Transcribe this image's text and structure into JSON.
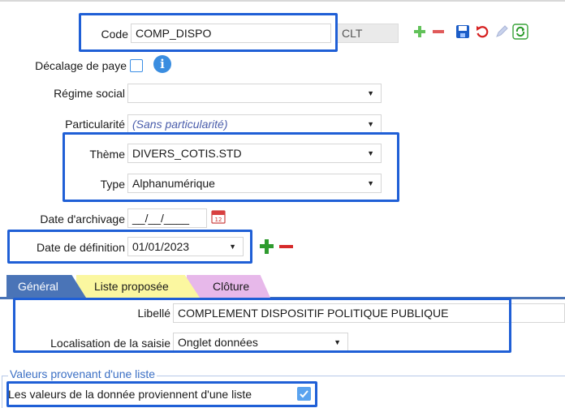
{
  "form": {
    "code": {
      "label": "Code",
      "value": "COMP_DISPO",
      "suffix": "CLT"
    },
    "decalage": {
      "label": "Décalage de paye"
    },
    "regime": {
      "label": "Régime social",
      "value": ""
    },
    "particularite": {
      "label": "Particularité",
      "value": "(Sans particularité)"
    },
    "theme": {
      "label": "Thème",
      "value": "DIVERS_COTIS.STD"
    },
    "type": {
      "label": "Type",
      "value": "Alphanumérique"
    },
    "archivage": {
      "label": "Date d'archivage",
      "value": "__/__/____"
    },
    "definition": {
      "label": "Date de définition",
      "value": "01/01/2023"
    }
  },
  "toolbar": {
    "icons": [
      "add-icon",
      "remove-icon",
      "save-icon",
      "undo-icon",
      "edit-icon",
      "refresh-icon"
    ]
  },
  "tabs": [
    {
      "label": "Général",
      "color": "#4a74b7"
    },
    {
      "label": "Liste proposée",
      "color": "#fbf7a0"
    },
    {
      "label": "Clôture",
      "color": "#e7b8ea"
    }
  ],
  "general": {
    "libelle": {
      "label": "Libellé",
      "value": "COMPLEMENT DISPOSITIF POLITIQUE PUBLIQUE"
    },
    "localisation": {
      "label": "Localisation de la saisie",
      "value": "Onglet données"
    }
  },
  "valeurs": {
    "group_title": "Valeurs provenant d'une liste",
    "checkbox_label": "Les valeurs de la donnée proviennent d'une liste",
    "checked": true
  }
}
